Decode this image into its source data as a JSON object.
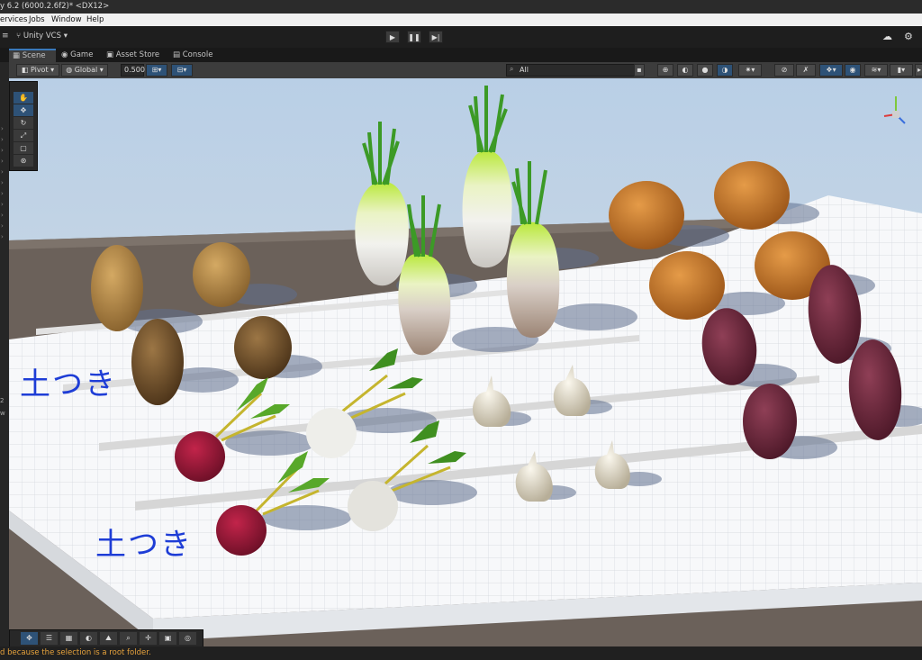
{
  "window": {
    "title": "y 6.2 (6000.2.6f2)* <DX12>"
  },
  "menu": {
    "items": [
      "ervices",
      "Jobs",
      "Window",
      "Help"
    ]
  },
  "toolbar": {
    "vcs_label": "Unity VCS",
    "play": "▶",
    "pause": "❚❚",
    "step": "▶|"
  },
  "tabs": [
    {
      "label": "Scene",
      "active": true
    },
    {
      "label": "Game",
      "active": false
    },
    {
      "label": "Asset Store",
      "active": false
    },
    {
      "label": "Console",
      "active": false
    }
  ],
  "scene_toolbar": {
    "pivot": "Pivot",
    "global": "Global",
    "snap_value": "0.500",
    "search_placeholder": "All"
  },
  "viewport": {
    "labels": [
      "土つき",
      "土つき"
    ],
    "side_numbers": [
      "2",
      "w"
    ]
  },
  "status": {
    "message": "d because the selection is a root folder."
  },
  "colors": {
    "accent": "#3a79bb",
    "status_warning": "#e6a23c",
    "label_blue": "#1e3dd6"
  }
}
